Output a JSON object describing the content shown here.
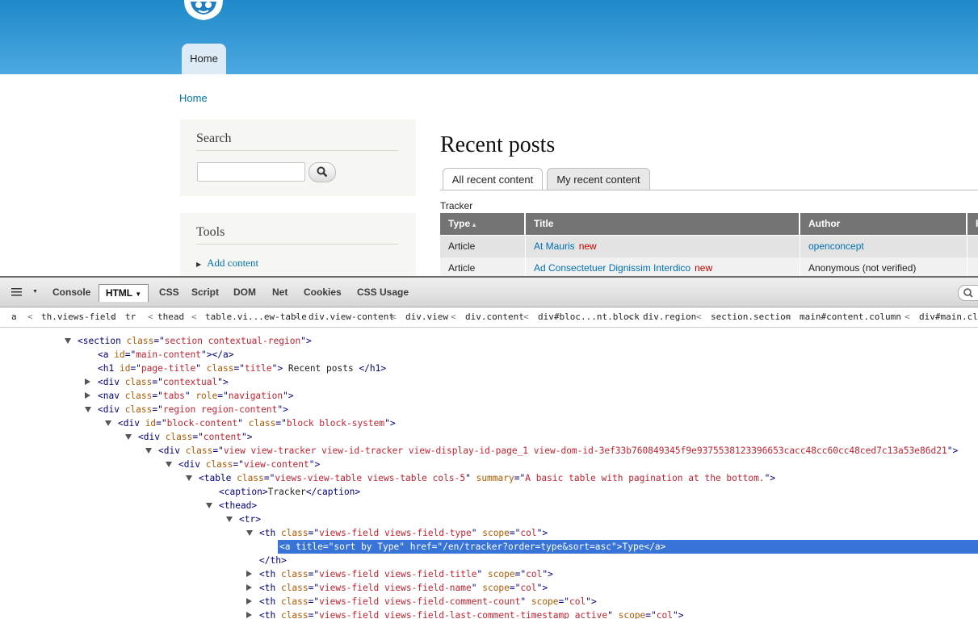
{
  "header": {
    "nav_home": "Home"
  },
  "breadcrumb": "Home",
  "sidebar": {
    "search_title": "Search",
    "tools_title": "Tools",
    "tools_link": "Add content"
  },
  "main": {
    "page_title": "Recent posts",
    "tabs": [
      "All recent content",
      "My recent content"
    ],
    "caption": "Tracker",
    "columns": [
      "Type",
      "Title",
      "Author",
      "R"
    ],
    "rows": [
      {
        "type": "Article",
        "title": "At Mauris",
        "flag": "new",
        "author": "openconcept"
      },
      {
        "type": "Article",
        "title": "Ad Consectetuer Dignissim Interdico",
        "flag": "new",
        "author": "Anonymous (not verified)"
      }
    ]
  },
  "devtools": {
    "tabs": [
      "Console",
      "HTML",
      "CSS",
      "Script",
      "DOM",
      "Net",
      "Cookies",
      "CSS Usage"
    ],
    "breadcrumbs": [
      "a",
      "th.views-field",
      "tr",
      "thead",
      "table.vi...ew-table",
      "div.view-content",
      "div.view",
      "div.content",
      "div#bloc...nt.block",
      "div.region",
      "section.section",
      "main#content.column",
      "div#main.clea"
    ],
    "tree": [
      {
        "indent": 0,
        "tw": "open",
        "t": "<section ",
        "a": [
          [
            "class",
            "section contextual-region"
          ]
        ],
        "e": ">"
      },
      {
        "indent": 1,
        "tw": "",
        "t": "<a ",
        "a": [
          [
            "id",
            "main-content"
          ]
        ],
        "e": "></a>"
      },
      {
        "indent": 1,
        "tw": "",
        "t": "<h1 ",
        "a": [
          [
            "id",
            "page-title"
          ],
          [
            "class",
            "title"
          ]
        ],
        "e": ">",
        "x": " Recent posts ",
        "c": "</h1>"
      },
      {
        "indent": 1,
        "tw": "closed",
        "t": "<div ",
        "a": [
          [
            "class",
            "contextual"
          ]
        ],
        "e": ">"
      },
      {
        "indent": 1,
        "tw": "closed",
        "t": "<nav ",
        "a": [
          [
            "class",
            "tabs"
          ],
          [
            "role",
            "navigation"
          ]
        ],
        "e": ">"
      },
      {
        "indent": 1,
        "tw": "open",
        "t": "<div ",
        "a": [
          [
            "class",
            "region region-content"
          ]
        ],
        "e": ">"
      },
      {
        "indent": 2,
        "tw": "open",
        "t": "<div ",
        "a": [
          [
            "id",
            "block-content"
          ],
          [
            "class",
            "block block-system"
          ]
        ],
        "e": ">"
      },
      {
        "indent": 3,
        "tw": "open",
        "t": "<div ",
        "a": [
          [
            "class",
            "content"
          ]
        ],
        "e": ">"
      },
      {
        "indent": 4,
        "tw": "open",
        "t": "<div ",
        "a": [
          [
            "class",
            "view view-tracker view-id-tracker view-display-id-page_1 view-dom-id-3ef33b760849345f9e9375538123396653cacc48cc60cc48ced7c13a53e86d21"
          ]
        ],
        "e": ">"
      },
      {
        "indent": 5,
        "tw": "open",
        "t": "<div ",
        "a": [
          [
            "class",
            "view-content"
          ]
        ],
        "e": ">"
      },
      {
        "indent": 6,
        "tw": "open",
        "t": "<table ",
        "a": [
          [
            "class",
            "views-view-table views-table cols-5"
          ],
          [
            "summary",
            "A basic table with pagination at the bottom."
          ]
        ],
        "e": ">"
      },
      {
        "indent": 7,
        "tw": "",
        "t": "<caption",
        "a": [],
        "e": ">",
        "x": "Tracker",
        "c": "</caption>"
      },
      {
        "indent": 7,
        "tw": "open",
        "t": "<thead",
        "a": [],
        "e": ">"
      },
      {
        "indent": 8,
        "tw": "open",
        "t": "<tr",
        "a": [],
        "e": ">"
      },
      {
        "indent": 9,
        "tw": "open",
        "t": "<th ",
        "a": [
          [
            "class",
            "views-field views-field-type"
          ],
          [
            "scope",
            "col"
          ]
        ],
        "e": ">"
      },
      {
        "indent": 10,
        "tw": "",
        "t": "<a ",
        "a": [
          [
            "title",
            "sort by Type"
          ],
          [
            "href",
            "/en/tracker?order=type&sort=asc"
          ]
        ],
        "e": ">",
        "x": "Type",
        "c": "</a>",
        "selected": true
      },
      {
        "indent": 9,
        "tw": "",
        "t": "</th>",
        "a": [],
        "e": ""
      },
      {
        "indent": 9,
        "tw": "closed",
        "t": "<th ",
        "a": [
          [
            "class",
            "views-field views-field-title"
          ],
          [
            "scope",
            "col"
          ]
        ],
        "e": ">"
      },
      {
        "indent": 9,
        "tw": "closed",
        "t": "<th ",
        "a": [
          [
            "class",
            "views-field views-field-name"
          ],
          [
            "scope",
            "col"
          ]
        ],
        "e": ">"
      },
      {
        "indent": 9,
        "tw": "closed",
        "t": "<th ",
        "a": [
          [
            "class",
            "views-field views-field-comment-count"
          ],
          [
            "scope",
            "col"
          ]
        ],
        "e": ">"
      },
      {
        "indent": 9,
        "tw": "closed",
        "t": "<th ",
        "a": [
          [
            "class",
            "views-field views-field-last-comment-timestamp active"
          ],
          [
            "scope",
            "col"
          ]
        ],
        "e": ">"
      }
    ]
  }
}
